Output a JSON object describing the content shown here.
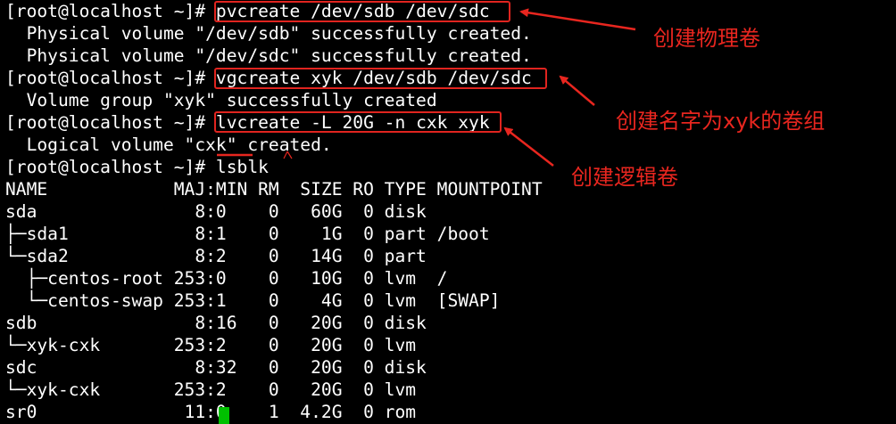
{
  "terminal": {
    "prompt": "[root@localhost ~]#",
    "lines": [
      {
        "prompt": "[root@localhost ~]#",
        "text": " pvcreate /dev/sdb /dev/sdc"
      },
      {
        "text": "  Physical volume \"/dev/sdb\" successfully created."
      },
      {
        "text": "  Physical volume \"/dev/sdc\" successfully created."
      },
      {
        "prompt": "[root@localhost ~]#",
        "text": " vgcreate xyk /dev/sdb /dev/sdc"
      },
      {
        "text": "  Volume group \"xyk\" successfully created"
      },
      {
        "prompt": "[root@localhost ~]#",
        "text": " lvcreate -L 20G -n cxk xyk"
      },
      {
        "text": "  Logical volume \"cxk\" created."
      },
      {
        "prompt": "[root@localhost ~]#",
        "text": " lsblk"
      },
      {
        "text": "NAME            MAJ:MIN RM  SIZE RO TYPE MOUNTPOINT"
      },
      {
        "text": "sda               8:0    0   60G  0 disk"
      },
      {
        "text": "├─sda1            8:1    0    1G  0 part /boot"
      },
      {
        "text": "└─sda2            8:2    0   14G  0 part"
      },
      {
        "text": "  ├─centos-root 253:0    0   10G  0 lvm  /"
      },
      {
        "text": "  └─centos-swap 253:1    0    4G  0 lvm  [SWAP]"
      },
      {
        "text": "sdb               8:16   0   20G  0 disk"
      },
      {
        "text": "└─xyk-cxk       253:2    0   20G  0 lvm"
      },
      {
        "text": "sdc               8:32   0   20G  0 disk"
      },
      {
        "text": "└─xyk-cxk       253:2    0   20G  0 lvm"
      },
      {
        "text": "sr0              11:0    1  4.2G  0 rom"
      }
    ]
  },
  "annotations": {
    "pv": "创建物理卷",
    "vg": "创建名字为xyk的卷组",
    "lv": "创建逻辑卷"
  },
  "colors": {
    "background": "#000000",
    "text": "#ffffff",
    "annotation": "#e8261f",
    "cursor": "#00c000"
  }
}
